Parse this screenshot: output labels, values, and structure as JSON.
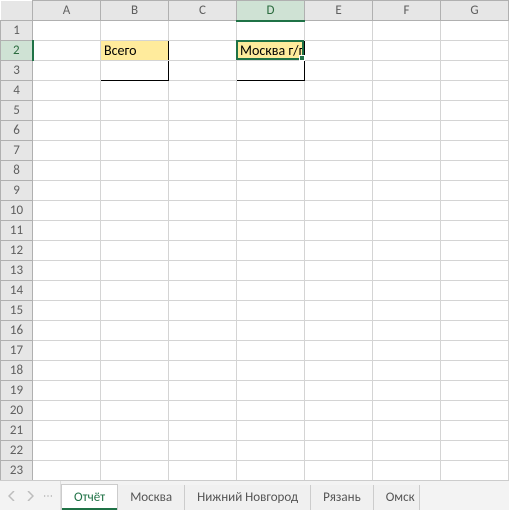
{
  "columns": [
    "A",
    "B",
    "C",
    "D",
    "E",
    "F",
    "G"
  ],
  "row_count": 23,
  "cells": {
    "B2": "Всего",
    "D2": "Москва г/г"
  },
  "active_cell": {
    "col_label": "D",
    "row_label": "2"
  },
  "tabs": {
    "items": [
      {
        "label": "Отчёт",
        "active": true
      },
      {
        "label": "Москва",
        "active": false
      },
      {
        "label": "Нижний Новгород",
        "active": false
      },
      {
        "label": "Рязань",
        "active": false
      },
      {
        "label": "Омск",
        "active": false
      }
    ]
  }
}
